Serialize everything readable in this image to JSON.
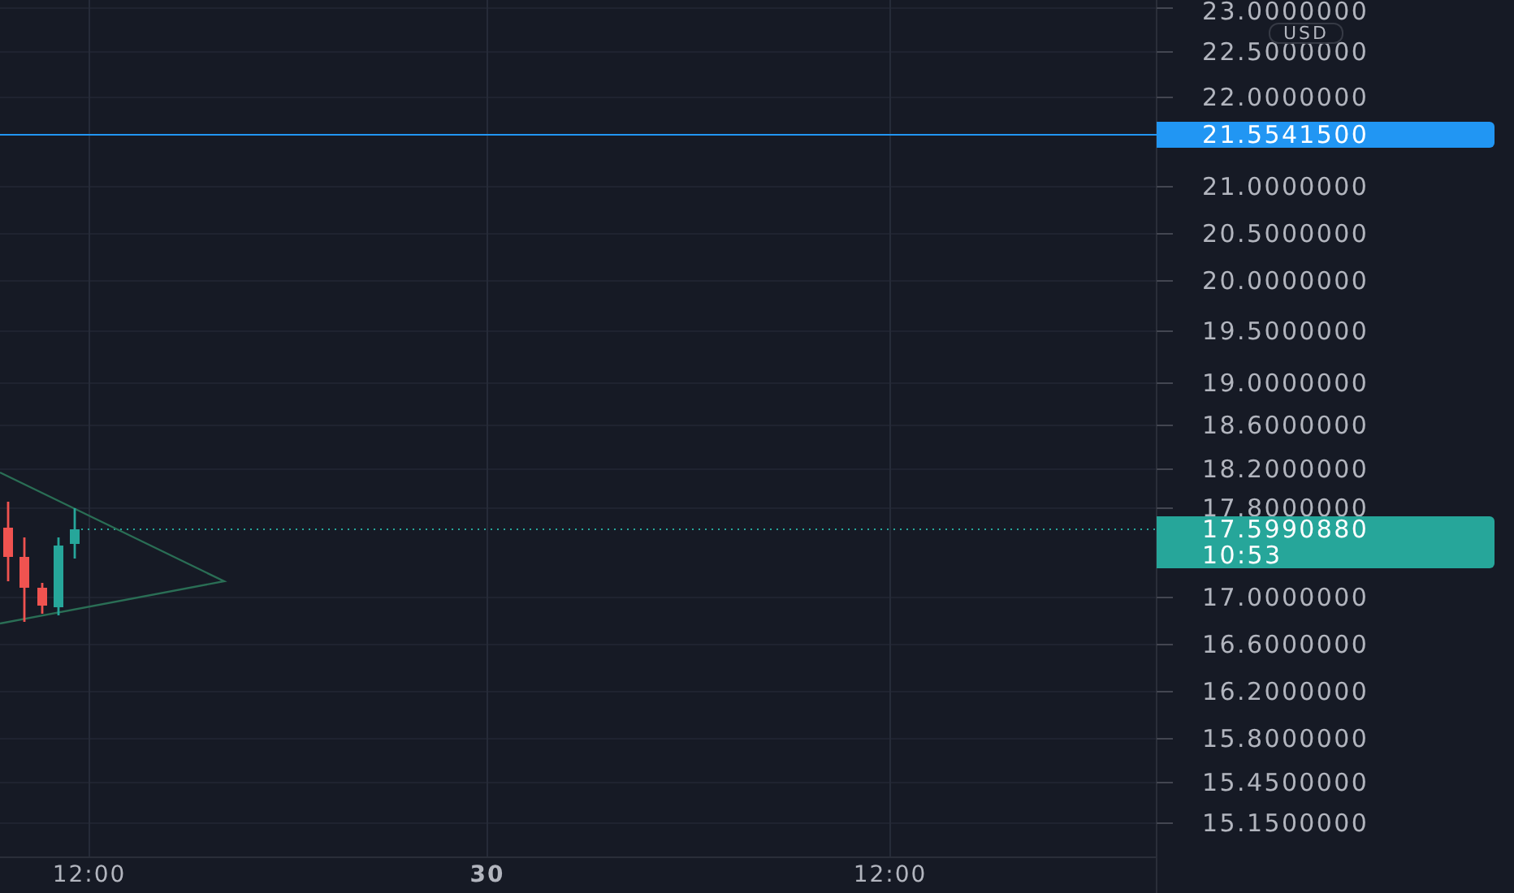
{
  "price_axis": {
    "currency_badge": "USD",
    "labels": [
      "23.0000000",
      "22.5000000",
      "22.0000000",
      "21.0000000",
      "20.5000000",
      "20.0000000",
      "19.5000000",
      "19.0000000",
      "18.6000000",
      "18.2000000",
      "17.8000000",
      "17.0000000",
      "16.6000000",
      "16.2000000",
      "15.8000000",
      "15.4500000",
      "15.1500000"
    ]
  },
  "price_markers": [
    {
      "price": "21.5541500",
      "color": "#2196f3"
    },
    {
      "price": "17.5990880",
      "countdown": "10:53",
      "color": "#26a69a"
    }
  ],
  "time_axis": {
    "labels": [
      {
        "text": "12:00",
        "kind": "time"
      },
      {
        "text": "30",
        "kind": "day"
      },
      {
        "text": "12:00",
        "kind": "time"
      }
    ]
  }
}
